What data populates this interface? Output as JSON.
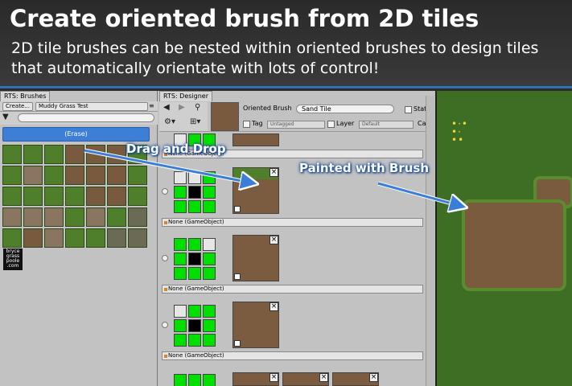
{
  "header": {
    "title": "Create oriented brush from 2D tiles",
    "subtitle": "2D tile brushes can be nested within oriented brushes to design tiles that automatically orientate with lots of control!"
  },
  "brushes_window": {
    "tab": "RTS: Brushes",
    "create_label": "Create...",
    "dropdown_label": "Muddy Grass Test",
    "erase_label": "(Erase)",
    "logo_text": "bryce grass poole .com"
  },
  "designer_window": {
    "tab": "RTS: Designer",
    "brush_type_label": "Oriented Brush",
    "brush_name": "Sand Tile",
    "static_label": "Static",
    "tag_label": "Tag",
    "tag_value": "Untagged",
    "layer_label": "Layer",
    "layer_value": "Default",
    "category_label": "Cate",
    "gameobject_field": "None (GameObject)"
  },
  "callouts": {
    "drag_and_drop": "Drag and Drop",
    "painted_with_brush": "Painted with Brush"
  },
  "colors": {
    "accent_blue": "#2f6fb8",
    "orientation_green": "#00e000",
    "grass": "#4f7f2b",
    "dirt": "#7b5b3d"
  }
}
